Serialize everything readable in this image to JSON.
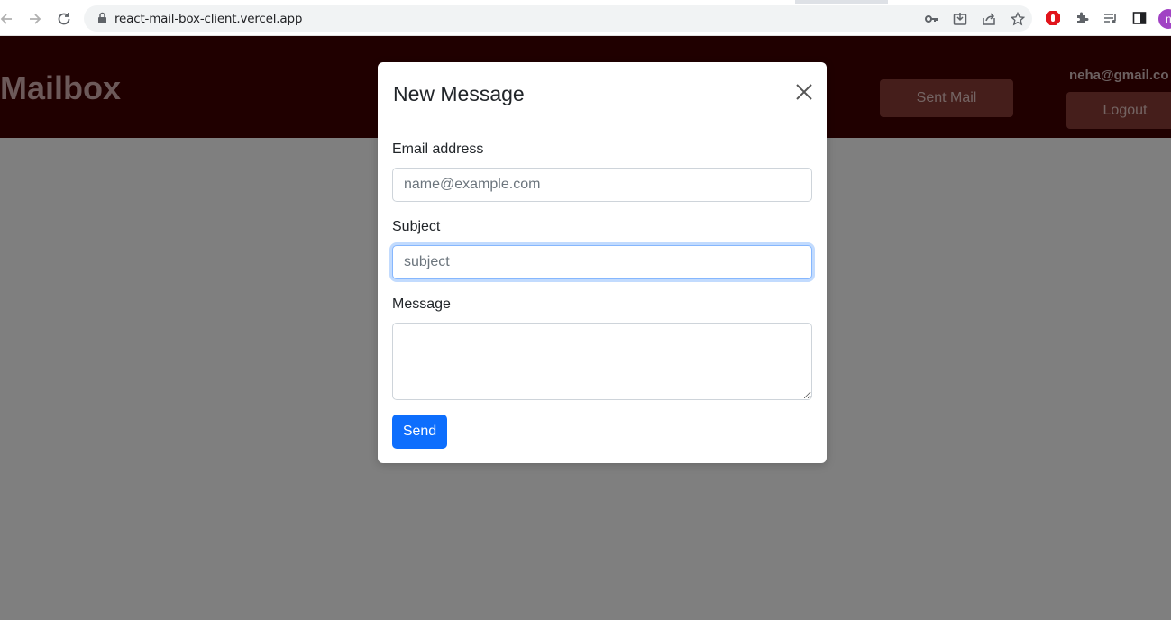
{
  "browser": {
    "url": "react-mail-box-client.vercel.app",
    "profile_initial": "n",
    "icons": [
      "back-arrow-icon",
      "forward-arrow-icon",
      "reload-icon",
      "lock-icon",
      "key-icon",
      "install-icon",
      "share-icon",
      "star-icon",
      "adblock-icon",
      "extensions-icon",
      "media-icon",
      "sidepanel-icon"
    ]
  },
  "header": {
    "brand": "Mailbox",
    "sent_mail_label": "Sent Mail",
    "user_email": "neha@gmail.co",
    "logout_label": "Logout"
  },
  "modal": {
    "title": "New Message",
    "email_label": "Email address",
    "email_placeholder": "name@example.com",
    "email_value": "",
    "subject_label": "Subject",
    "subject_placeholder": "subject",
    "subject_value": "",
    "message_label": "Message",
    "message_value": "",
    "send_label": "Send"
  },
  "colors": {
    "header_bg": "#410000",
    "header_button_bg": "#8a3d37",
    "primary": "#0d6efd",
    "focus_ring": "#86b7fe"
  }
}
